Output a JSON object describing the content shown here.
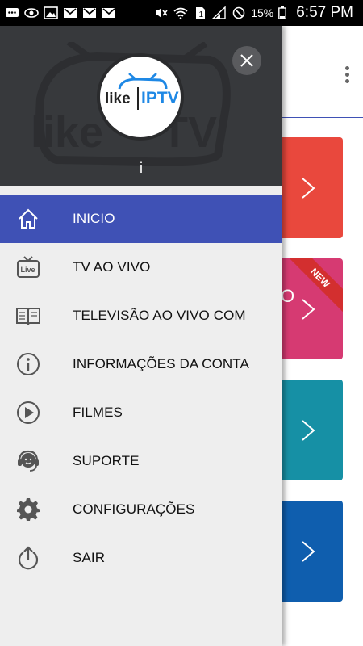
{
  "status_bar": {
    "battery_percent": "15%",
    "time": "6:57 PM"
  },
  "drawer": {
    "header": {
      "logo_text_left": "like",
      "logo_text_right": "IPTV",
      "user_name": "i"
    },
    "menu": [
      {
        "label": "INICIO",
        "icon": "home-icon",
        "active": true
      },
      {
        "label": "TV AO VIVO",
        "icon": "live-tv-icon",
        "active": false
      },
      {
        "label": "TELEVISÃO AO VIVO COM",
        "icon": "book-icon",
        "active": false
      },
      {
        "label": "INFORMAÇÕES DA CONTA",
        "icon": "info-icon",
        "active": false
      },
      {
        "label": "FILMES",
        "icon": "play-icon",
        "active": false
      },
      {
        "label": "SUPORTE",
        "icon": "support-icon",
        "active": false
      },
      {
        "label": "CONFIGURAÇÕES",
        "icon": "gear-icon",
        "active": false
      },
      {
        "label": "SAIR",
        "icon": "logout-icon",
        "active": false
      }
    ]
  },
  "background": {
    "cards": [
      {
        "color": "#e9483d"
      },
      {
        "color": "#d63a72",
        "badge": "NEW"
      },
      {
        "color": "#1690a5"
      },
      {
        "color": "#0f5eae"
      }
    ],
    "partial_text": "O"
  },
  "colors": {
    "accent": "#3f51b5",
    "drawer_header": "#37393c",
    "logo_blue": "#1e88e5"
  }
}
